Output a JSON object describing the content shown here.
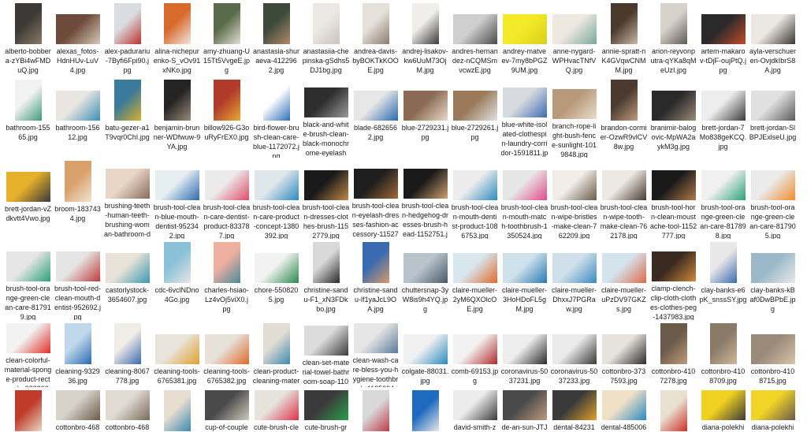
{
  "files": [
    {
      "name": "alberto-bobbera-zYBi4wFMDuQ.jpg",
      "shape": "portrait",
      "colors": [
        "#3c3a36",
        "#8a7a66"
      ]
    },
    {
      "name": "alexas_fotos-HdnHUv-LuV4.jpg",
      "shape": "landscape",
      "colors": [
        "#6e4a3a",
        "#d6c9b8"
      ]
    },
    {
      "name": "alex-padurariu-7Byfi6Fpi90.jpg",
      "shape": "portrait",
      "colors": [
        "#d9dde2",
        "#c0302c"
      ]
    },
    {
      "name": "alina-nichepurenko-S_vOv91xNKo.jpg",
      "shape": "portrait",
      "colors": [
        "#d76a2c",
        "#f0e6dc"
      ]
    },
    {
      "name": "amy-zhuang-U15Tt5VvgeE.jpg",
      "shape": "portrait",
      "colors": [
        "#5a6b4a",
        "#e2ddd2"
      ]
    },
    {
      "name": "anastasia-shuraeva-4122962.jpg",
      "shape": "portrait",
      "colors": [
        "#3d4a3a",
        "#b08a6a"
      ]
    },
    {
      "name": "anastasiia-chepinska-gSdhs5DJ1bg.jpg",
      "shape": "portrait",
      "colors": [
        "#ece9e4",
        "#c9c4bc"
      ]
    },
    {
      "name": "andrea-davis-byBOKTkKOOE.jpg",
      "shape": "portrait",
      "colors": [
        "#e5e1da",
        "#8a7c6c"
      ]
    },
    {
      "name": "andrej-lisakov-kw6UuM73OjM.jpg",
      "shape": "portrait",
      "colors": [
        "#f0eeea",
        "#3a3a3a"
      ]
    },
    {
      "name": "andres-hernandez-nCQMSmvcwzE.jpg",
      "shape": "landscape",
      "colors": [
        "#cfcfcf",
        "#4a4a4a"
      ]
    },
    {
      "name": "andrey-matveev-7my8bPGZ9UM.jpg",
      "shape": "landscape",
      "colors": [
        "#f4ea2a",
        "#d8cf18"
      ]
    },
    {
      "name": "anne-nygard-WPHvacTNfVQ.jpg",
      "shape": "landscape",
      "colors": [
        "#efe8e0",
        "#7aa89a"
      ]
    },
    {
      "name": "annie-spratt-nK4GVqwCNMM.jpg",
      "shape": "portrait",
      "colors": [
        "#4a3a2c",
        "#c9b9a4"
      ]
    },
    {
      "name": "arion-reyvonputra-qYKa8qMeUzI.jpg",
      "shape": "portrait",
      "colors": [
        "#d7d3cc",
        "#5e5a54"
      ]
    },
    {
      "name": "artem-makarov-tDjF-oujPtQ.jpg",
      "shape": "landscape",
      "colors": [
        "#2a2a2a",
        "#c04a2a"
      ]
    },
    {
      "name": "ayla-verschueren-OvjdkIbrS8A.jpg",
      "shape": "landscape",
      "colors": [
        "#ebe8e4",
        "#3a3633"
      ]
    },
    {
      "name": "bathroom-15565.jpg",
      "shape": "portrait",
      "colors": [
        "#f2f2f2",
        "#3f9a7a"
      ]
    },
    {
      "name": "bathroom-15612.jpg",
      "shape": "landscape",
      "colors": [
        "#e9e6e1",
        "#3c8fb6"
      ]
    },
    {
      "name": "batu-gezer-a1T9vqr0ChI.jpg",
      "shape": "portrait",
      "colors": [
        "#3a7a9a",
        "#d8b02a"
      ]
    },
    {
      "name": "benjamin-brunner-WDfwuw-9YA.jpg",
      "shape": "portrait",
      "colors": [
        "#242424",
        "#9a8a7a"
      ]
    },
    {
      "name": "billow926-G3ouRyFrEX0.jpg",
      "shape": "portrait",
      "colors": [
        "#b23a2a",
        "#e6a832"
      ]
    },
    {
      "name": "bird-flower-brush-clean-care-blue-1172072.jpg",
      "shape": "portrait",
      "colors": [
        "#ffffff",
        "#2f6fb8"
      ]
    },
    {
      "name": "black-and-white-brush-clean-black-monochrome-eyelash-…",
      "shape": "landscape",
      "colors": [
        "#2e2e2e",
        "#9a9a9a"
      ]
    },
    {
      "name": "blade-6826562.jpg",
      "shape": "landscape",
      "colors": [
        "#e7e7e7",
        "#2a6ab0"
      ]
    },
    {
      "name": "blue-2729231.jpg",
      "shape": "landscape",
      "colors": [
        "#8a6a52",
        "#e8d8c8"
      ]
    },
    {
      "name": "blue-2729261.jpg",
      "shape": "landscape",
      "colors": [
        "#9a7a5a",
        "#e2e2e2"
      ]
    },
    {
      "name": "blue-white-isolated-clothespin-laundry-corridor-1591811.jpg",
      "shape": "landscape",
      "colors": [
        "#d7dbe0",
        "#3a6ab0"
      ]
    },
    {
      "name": "branch-rope-light-bush-fence-sunlight-1019848.jpg",
      "shape": "landscape",
      "colors": [
        "#b89a7a",
        "#e8dccc"
      ]
    },
    {
      "name": "brandon-cormier-OzwR9vlCV8w.jpg",
      "shape": "portrait",
      "colors": [
        "#4a3a30",
        "#c09a7a"
      ]
    },
    {
      "name": "branimir-balogovic-MpWA2aykM3g.jpg",
      "shape": "landscape",
      "colors": [
        "#2a2a2a",
        "#9a8a7a"
      ]
    },
    {
      "name": "brett-jordan-7Mo838geKCQ.jpg",
      "shape": "landscape",
      "colors": [
        "#ededed",
        "#3a3a3a"
      ]
    },
    {
      "name": "brett-jordan-SlBPJExlseU.jpg",
      "shape": "landscape",
      "colors": [
        "#e0e0e0",
        "#5a5a5a"
      ]
    },
    {
      "name": "brett-jordan-vZdkvtt4Vwo.jpg",
      "shape": "landscape",
      "colors": [
        "#e6b02a",
        "#3a3a3a"
      ]
    },
    {
      "name": "broom-1837434.jpg",
      "shape": "portrait",
      "colors": [
        "#d8a06a",
        "#f0e4d2"
      ]
    },
    {
      "name": "brushing-teeth-human-teeth-brushing-woman-bathroom-de…",
      "shape": "landscape",
      "colors": [
        "#e8d7c6",
        "#8a6a5a"
      ]
    },
    {
      "name": "brush-tool-clean-blue-mouth-dentist-952342.jpg",
      "shape": "landscape",
      "colors": [
        "#e6eef2",
        "#2a6ab0"
      ]
    },
    {
      "name": "brush-tool-clean-care-dentist-product-833787.jpg",
      "shape": "landscape",
      "colors": [
        "#eaeaea",
        "#e04a6a"
      ]
    },
    {
      "name": "brush-tool-clean-care-product-concept-1380392.jpg",
      "shape": "landscape",
      "colors": [
        "#dfe6ea",
        "#2a8ac0"
      ]
    },
    {
      "name": "brush-tool-clean-dresses-clothes-brush-1152779.jpg",
      "shape": "landscape",
      "colors": [
        "#1a1a1a",
        "#c08a4a"
      ]
    },
    {
      "name": "brush-tool-clean-eyelash-dresses-fashion-accessory-115273…",
      "shape": "landscape",
      "colors": [
        "#1e1e1e",
        "#a06a3a"
      ]
    },
    {
      "name": "brush-tool-clean-hedgehog-dresses-brush-head-1152751.jpg",
      "shape": "landscape",
      "colors": [
        "#1a1a1a",
        "#d0a070"
      ]
    },
    {
      "name": "brush-tool-clean-mouth-dentist-product-1086753.jpg",
      "shape": "landscape",
      "colors": [
        "#ececec",
        "#2a8ac0"
      ]
    },
    {
      "name": "brush-tool-clean-mouth-match-toothbrush-1350524.jpg",
      "shape": "landscape",
      "colors": [
        "#e6e6e6",
        "#e04a8a"
      ]
    },
    {
      "name": "brush-tool-clean-wipe-bristles-make-clean-762209.jpg",
      "shape": "landscape",
      "colors": [
        "#f0ece6",
        "#6a5a4a"
      ]
    },
    {
      "name": "brush-tool-clean-wipe-tooth-make-clean-762178.jpg",
      "shape": "landscape",
      "colors": [
        "#ece8e2",
        "#4a3a30"
      ]
    },
    {
      "name": "brush-tool-horn-clean-moustache-tool-1152777.jpg",
      "shape": "landscape",
      "colors": [
        "#1a1a1a",
        "#b07a4a"
      ]
    },
    {
      "name": "brush-tool-orange-green-clean-care-817898.jpg",
      "shape": "landscape",
      "colors": [
        "#f0f0f0",
        "#2aa07a"
      ]
    },
    {
      "name": "brush-tool-orange-green-clean-care-817905.jpg",
      "shape": "landscape",
      "colors": [
        "#eaeaea",
        "#f08a2a"
      ]
    },
    {
      "name": "brush-tool-orange-green-clean-care-817919.jpg",
      "shape": "landscape",
      "colors": [
        "#e6e6e6",
        "#2aa07a"
      ]
    },
    {
      "name": "brush-tool-red-clean-mouth-dentist-952692.jpg",
      "shape": "landscape",
      "colors": [
        "#e4e4e4",
        "#c03a3a"
      ]
    },
    {
      "name": "castorlystock-3654607.jpg",
      "shape": "landscape",
      "colors": [
        "#e8e2d8",
        "#3a9ab0"
      ]
    },
    {
      "name": "cdc-6vclNDno4Go.jpg",
      "shape": "portrait",
      "colors": [
        "#8ac0d8",
        "#e6e6e6"
      ]
    },
    {
      "name": "charles-hsiao-Lz4vOj5viX0.jpg",
      "shape": "portrait",
      "colors": [
        "#f0b0a0",
        "#4a8a9a"
      ]
    },
    {
      "name": "chore-5508205.jpg",
      "shape": "landscape",
      "colors": [
        "#f2f2f2",
        "#2a8a4a"
      ]
    },
    {
      "name": "christine-sandu-F1_xN3FDkbo.jpg",
      "shape": "portrait",
      "colors": [
        "#d8d8d8",
        "#2a2a2a"
      ]
    },
    {
      "name": "christine-sandu-lf1yaJcL9OA.jpg",
      "shape": "portrait",
      "colors": [
        "#3a6ab0",
        "#d89a6a"
      ]
    },
    {
      "name": "chuttersnap-3yW8is9h4YQ.jpg",
      "shape": "landscape",
      "colors": [
        "#b8c4cc",
        "#4a5a6a"
      ]
    },
    {
      "name": "claire-mueller-2yM6QXOlcOE.jpg",
      "shape": "landscape",
      "colors": [
        "#d8e6ee",
        "#e06a2a"
      ]
    },
    {
      "name": "claire-mueller-3HoHDoFL5gM.jpg",
      "shape": "landscape",
      "colors": [
        "#cfe2ec",
        "#2a7ab0"
      ]
    },
    {
      "name": "claire-mueller-DhxxJ7PGRaw.jpg",
      "shape": "landscape",
      "colors": [
        "#cfe0ea",
        "#3a8ac0"
      ]
    },
    {
      "name": "claire-mueller-uPzDV97GKZs.jpg",
      "shape": "landscape",
      "colors": [
        "#d4e4ec",
        "#e06a4a"
      ]
    },
    {
      "name": "clamp-clench-clip-cloth-clothes-clothes-peg-1437983.jpg",
      "shape": "landscape",
      "colors": [
        "#3a2a20",
        "#d08a3a"
      ]
    },
    {
      "name": "clay-banks-e6pK_snssSY.jpg",
      "shape": "portrait",
      "colors": [
        "#e8e8e8",
        "#3a6ab0"
      ]
    },
    {
      "name": "clay-banks-kBaf0DwBPbE.jpg",
      "shape": "landscape",
      "colors": [
        "#9ab8c8",
        "#e8e8e8"
      ]
    },
    {
      "name": "clean-colorful-material-sponge-product-rectangle-988802.j…",
      "shape": "landscape",
      "colors": [
        "#f2f2f2",
        "#e0302a"
      ]
    },
    {
      "name": "cleaning-932936.jpg",
      "shape": "portrait",
      "colors": [
        "#c0d8ea",
        "#2a6ab0"
      ]
    },
    {
      "name": "cleaning-8067778.jpg",
      "shape": "portrait",
      "colors": [
        "#f0ece6",
        "#3a6ab0"
      ]
    },
    {
      "name": "cleaning-tools-6765381.jpg",
      "shape": "landscape",
      "colors": [
        "#e8e4dc",
        "#e0a02a"
      ]
    },
    {
      "name": "cleaning-tools-6765382.jpg",
      "shape": "landscape",
      "colors": [
        "#e6e2da",
        "#e06a2a"
      ]
    },
    {
      "name": "clean-product-cleaning-material-cleanliness-make-clean-fr-h…",
      "shape": "portrait",
      "colors": [
        "#e2dcd2",
        "#3a8ab0"
      ]
    },
    {
      "name": "clean-set-material-towel-bathroom-soap-1109382.jpg",
      "shape": "landscape",
      "colors": [
        "#dcdcdc",
        "#3a3a3a"
      ]
    },
    {
      "name": "clean-wash-care-bless-you-hygiene-toothbrush-1125294.jpg",
      "shape": "landscape",
      "colors": [
        "#e6e6e6",
        "#5a7a9a"
      ]
    },
    {
      "name": "colgate-88031.jpg",
      "shape": "landscape",
      "colors": [
        "#f0f0f0",
        "#2a8ac0"
      ]
    },
    {
      "name": "comb-69153.jpg",
      "shape": "landscape",
      "colors": [
        "#f2f2f2",
        "#b02a2a"
      ]
    },
    {
      "name": "coronavirus-5037231.jpg",
      "shape": "landscape",
      "colors": [
        "#ededed",
        "#2a2a2a"
      ]
    },
    {
      "name": "coronavirus-5037233.jpg",
      "shape": "landscape",
      "colors": [
        "#eaeaea",
        "#3a3a3a"
      ]
    },
    {
      "name": "cottonbro-3737593.jpg",
      "shape": "landscape",
      "colors": [
        "#e6e2dc",
        "#2a2a2a"
      ]
    },
    {
      "name": "cottonbro-4107278.jpg",
      "shape": "portrait",
      "colors": [
        "#6a5a4a",
        "#c09a7a"
      ]
    },
    {
      "name": "cottonbro-4108709.jpg",
      "shape": "portrait",
      "colors": [
        "#8a7a6a",
        "#d0b898"
      ]
    },
    {
      "name": "cottonbro-4108715.jpg",
      "shape": "landscape",
      "colors": [
        "#9a8a7a",
        "#d8c4a8"
      ]
    },
    {
      "name": "cottonbro-4108…",
      "shape": "portrait",
      "colors": [
        "#c03a2a",
        "#e8d8c4"
      ]
    },
    {
      "name": "cottonbro-4684…",
      "shape": "landscape",
      "colors": [
        "#d8d2ca",
        "#6a5a4a"
      ]
    },
    {
      "name": "cottonbro-4684…",
      "shape": "landscape",
      "colors": [
        "#e0dad2",
        "#7a6a5a"
      ]
    },
    {
      "name": "crystal-de-passi…",
      "shape": "portrait",
      "colors": [
        "#e6dcd0",
        "#3a8ab0"
      ]
    },
    {
      "name": "cup-of-couple-…",
      "shape": "landscape",
      "colors": [
        "#4a4a4a",
        "#d0c8bc"
      ]
    },
    {
      "name": "cute-brush-clea…",
      "shape": "landscape",
      "colors": [
        "#e6e2dc",
        "#e0304a"
      ]
    },
    {
      "name": "cute-brush-gre…",
      "shape": "landscape",
      "colors": [
        "#3a3a3a",
        "#2aa04a"
      ]
    },
    {
      "name": "daniel-fam-YiEC…",
      "shape": "portrait",
      "colors": [
        "#d8d8d8",
        "#c03a4a"
      ]
    },
    {
      "name": "danilo-alvesd-U…",
      "shape": "portrait",
      "colors": [
        "#1e6ac0",
        "#e6e6e6"
      ]
    },
    {
      "name": "david-smith-zX…",
      "shape": "landscape",
      "colors": [
        "#ececec",
        "#3a3a3a"
      ]
    },
    {
      "name": "de-an-sun-JTJr…",
      "shape": "landscape",
      "colors": [
        "#4a4a4a",
        "#c09a7a"
      ]
    },
    {
      "name": "dental-842314.j…",
      "shape": "landscape",
      "colors": [
        "#3a3a3a",
        "#e0a02a"
      ]
    },
    {
      "name": "dental-4850065…",
      "shape": "landscape",
      "colors": [
        "#f0e0c8",
        "#2a8ac0"
      ]
    },
    {
      "name": "dfy-tukhQkLVb…",
      "shape": "portrait",
      "colors": [
        "#e8e0d0",
        "#d0302a"
      ]
    },
    {
      "name": "diana-polekhin…",
      "shape": "landscape",
      "colors": [
        "#f0d020",
        "#3a3a3a"
      ]
    },
    {
      "name": "diana-polekhin…",
      "shape": "landscape",
      "colors": [
        "#f2d428",
        "#6a5a4a"
      ]
    }
  ]
}
